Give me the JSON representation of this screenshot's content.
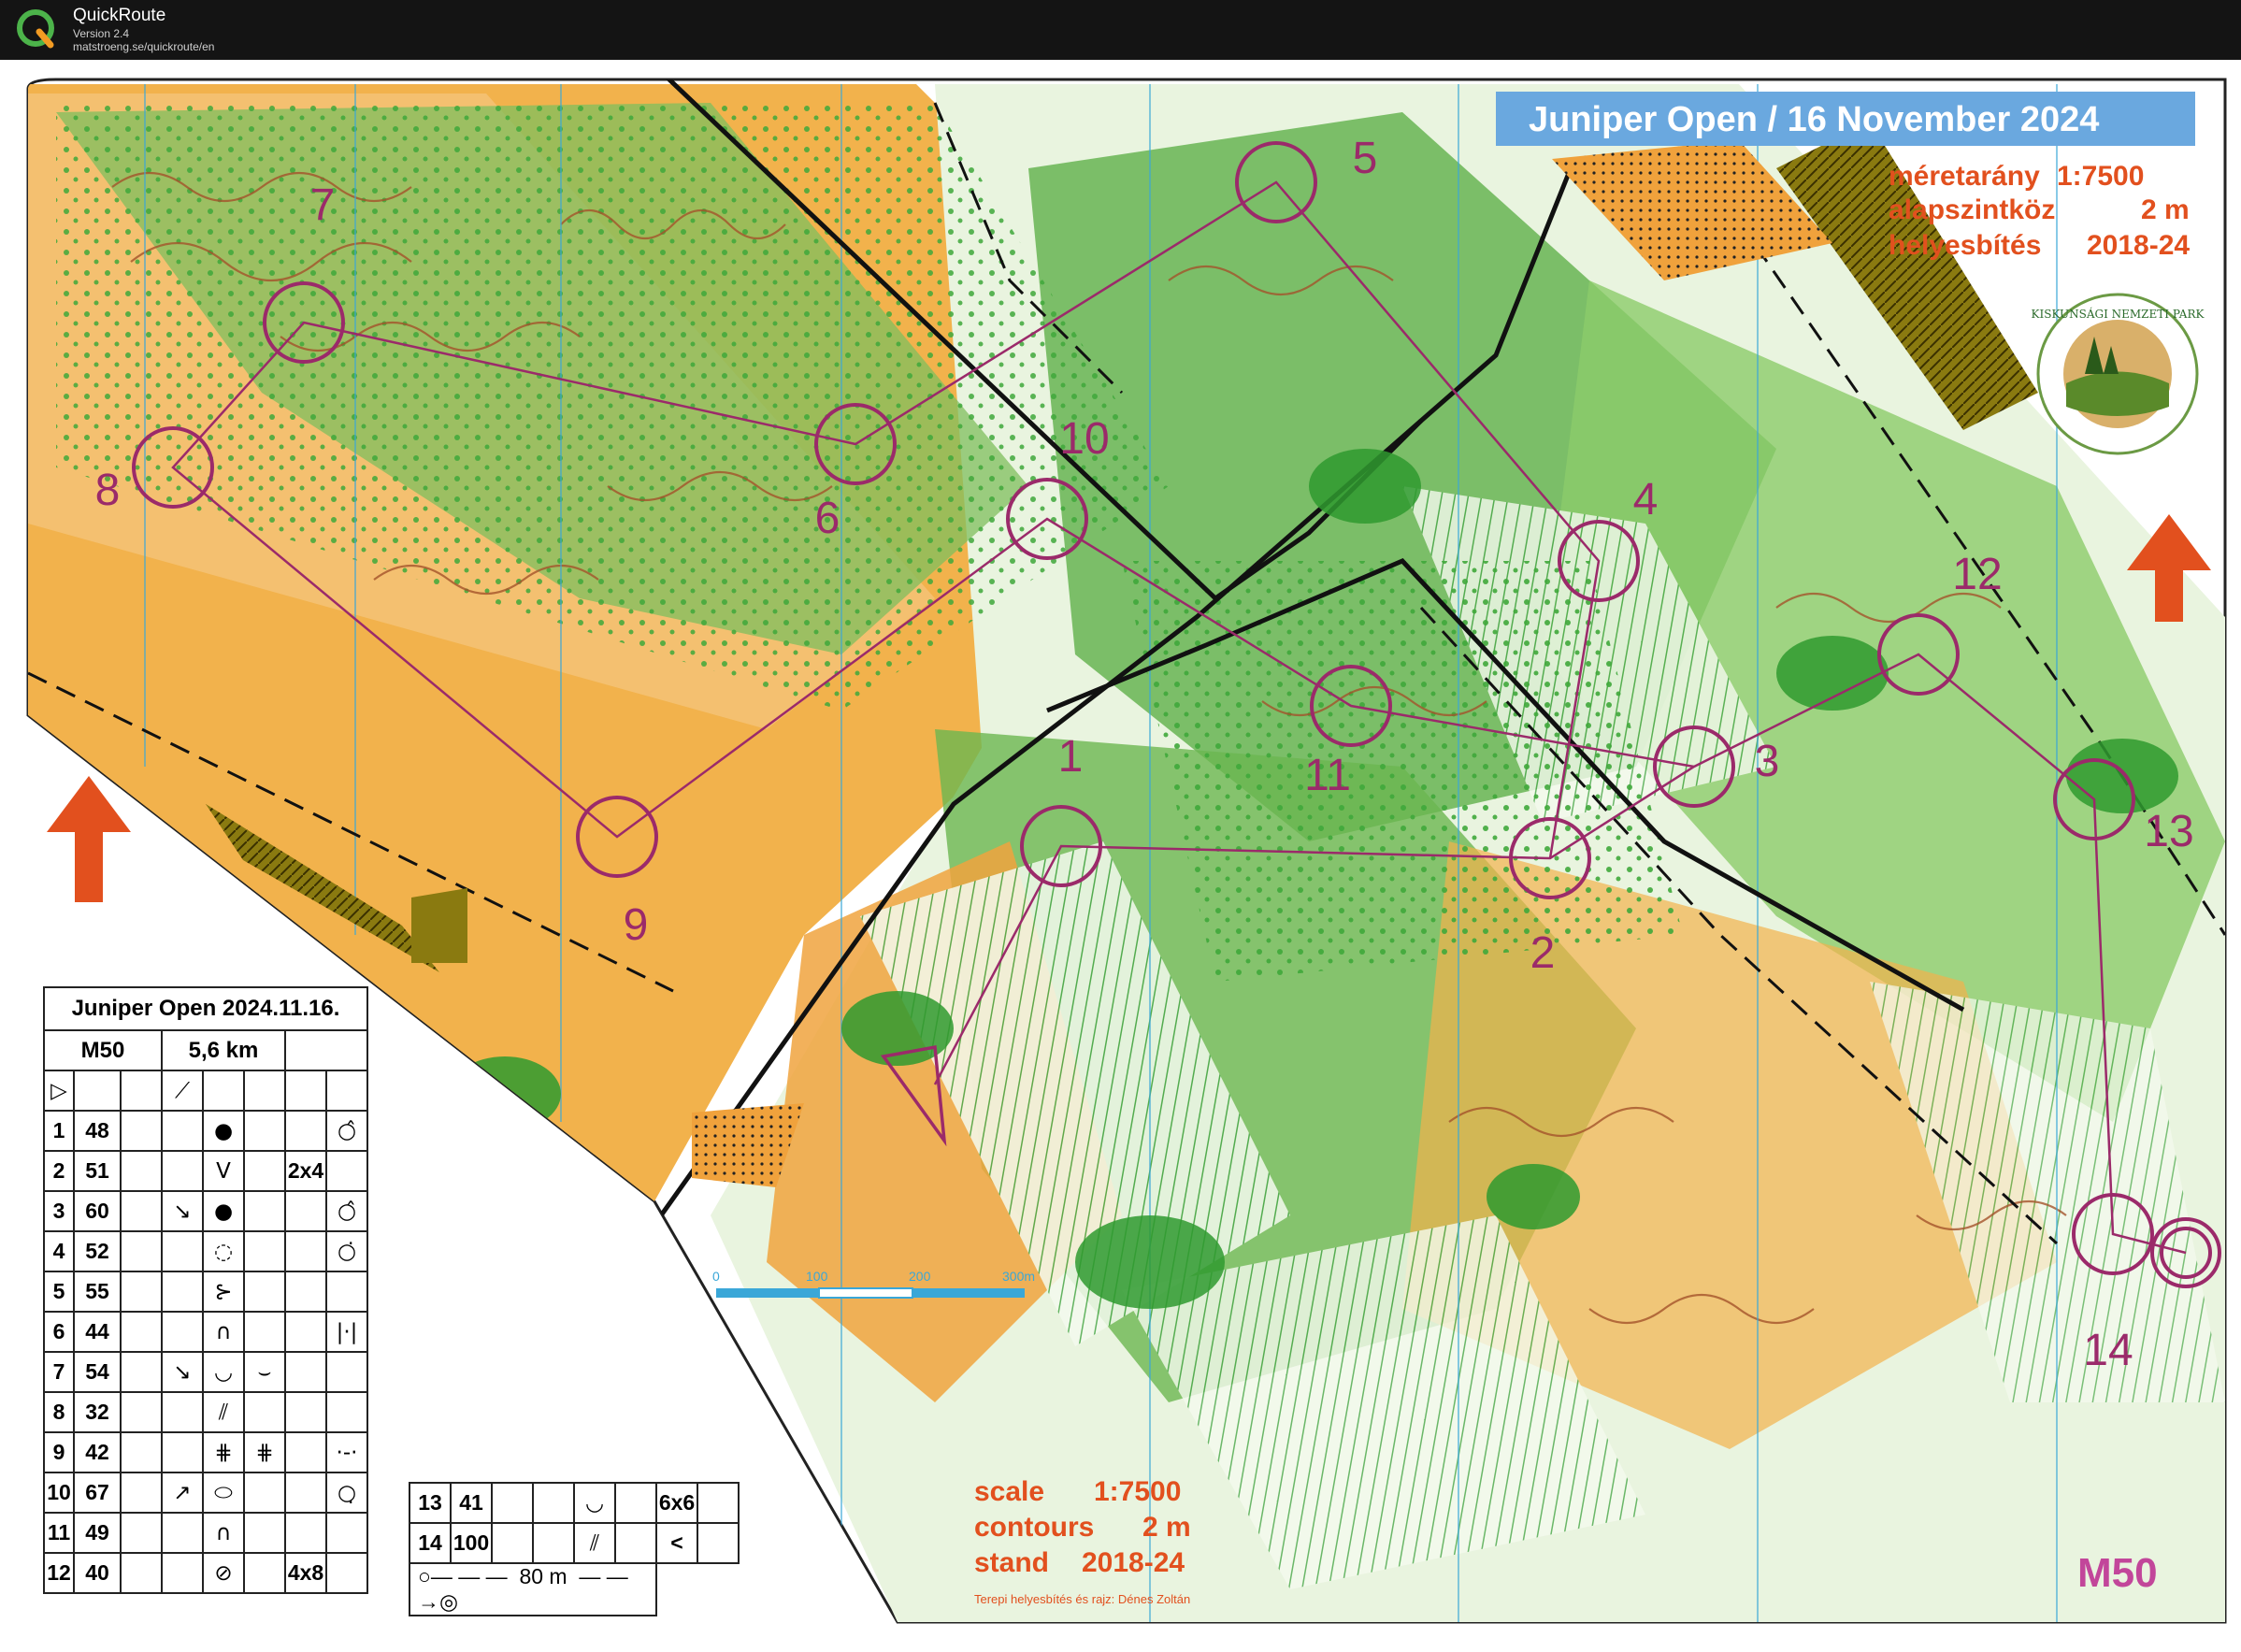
{
  "app": {
    "name": "QuickRoute",
    "version": "Version 2.4",
    "url": "matstroeng.se/quickroute/en"
  },
  "map": {
    "banner": "Juniper Open  /  16 November 2024",
    "hu_info": [
      {
        "label": "méretarány",
        "value": "1:7500"
      },
      {
        "label": "alapszintköz",
        "value": "2 m"
      },
      {
        "label": "helyesbítés",
        "value": "2018-24"
      }
    ],
    "en_info": [
      {
        "label": "scale",
        "value": "1:7500"
      },
      {
        "label": "contours",
        "value": "2 m"
      },
      {
        "label": "stand",
        "value": "2018-24"
      }
    ],
    "credit": "Terepi helyesbítés és rajz: Dénes Zoltán",
    "class_label": "M50",
    "park_logo_text": "KISKUNSÁGI NEMZETI PARK",
    "scalebar": {
      "ticks": [
        "0",
        "100",
        "200",
        "300m"
      ]
    },
    "controls": [
      {
        "n": "1"
      },
      {
        "n": "2"
      },
      {
        "n": "3"
      },
      {
        "n": "4"
      },
      {
        "n": "5"
      },
      {
        "n": "6"
      },
      {
        "n": "7"
      },
      {
        "n": "8"
      },
      {
        "n": "9"
      },
      {
        "n": "10"
      },
      {
        "n": "11"
      },
      {
        "n": "12"
      },
      {
        "n": "13"
      },
      {
        "n": "14"
      }
    ],
    "colors": {
      "course": "#9b2a6a",
      "forest_green": "#3fa83a",
      "open_orange": "#f2a640",
      "contour": "#a4522a",
      "water": "#3aa7d8",
      "north": "#e2501e"
    }
  },
  "description": {
    "title": "Juniper Open 2024.11.16.",
    "class": "M50",
    "length": "5,6 km",
    "rows": [
      {
        "n": "1",
        "code": "48",
        "d": "",
        "f": "●",
        "g": "",
        "h": "",
        "i": "○̂"
      },
      {
        "n": "2",
        "code": "51",
        "d": "",
        "f": "V",
        "g": "",
        "h": "2x4",
        "i": ""
      },
      {
        "n": "3",
        "code": "60",
        "d": "↘",
        "f": "●",
        "g": "",
        "h": "",
        "i": "○̂"
      },
      {
        "n": "4",
        "code": "52",
        "d": "",
        "f": "◌",
        "g": "",
        "h": "",
        "i": "○̇"
      },
      {
        "n": "5",
        "code": "55",
        "d": "",
        "f": "⊱",
        "g": "",
        "h": "",
        "i": ""
      },
      {
        "n": "6",
        "code": "44",
        "d": "",
        "f": "∩",
        "g": "",
        "h": "",
        "i": "|·|"
      },
      {
        "n": "7",
        "code": "54",
        "d": "↘",
        "f": "◡",
        "g": "⌣",
        "h": "",
        "i": ""
      },
      {
        "n": "8",
        "code": "32",
        "d": "",
        "f": "⫽",
        "g": "",
        "h": "",
        "i": ""
      },
      {
        "n": "9",
        "code": "42",
        "d": "",
        "f": "⋕",
        "g": "⋕",
        "h": "",
        "i": "·-·"
      },
      {
        "n": "10",
        "code": "67",
        "d": "↗",
        "f": "⬭",
        "g": "",
        "h": "",
        "i": "○̣"
      },
      {
        "n": "11",
        "code": "49",
        "d": "",
        "f": "∩",
        "g": "",
        "h": "",
        "i": ""
      },
      {
        "n": "12",
        "code": "40",
        "d": "",
        "f": "⊘",
        "g": "",
        "h": "4x8",
        "i": ""
      }
    ],
    "rows2": [
      {
        "n": "13",
        "code": "41",
        "d": "",
        "f": "◡",
        "g": "",
        "h": "6x6",
        "i": ""
      },
      {
        "n": "14",
        "code": "100",
        "d": "",
        "f": "⫽",
        "g": "",
        "h": "<",
        "i": ""
      }
    ],
    "finish_dist": "80 m"
  }
}
